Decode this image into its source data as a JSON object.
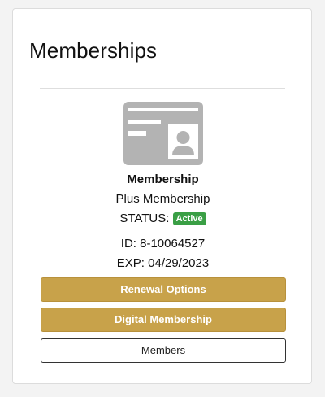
{
  "page": {
    "title": "Memberships"
  },
  "membership": {
    "icon": "membership-card-icon",
    "heading": "Membership",
    "plan": "Plus Membership",
    "status_label": "STATUS:",
    "status_value": "Active",
    "id_text": "ID: 8-10064527",
    "exp_text": "EXP: 04/29/2023"
  },
  "actions": {
    "renewal_label": "Renewal Options",
    "digital_label": "Digital Membership",
    "members_label": "Members"
  },
  "colors": {
    "accent_gold": "#c8a24a",
    "status_green": "#3a9f45",
    "icon_gray": "#b3b3b3"
  }
}
